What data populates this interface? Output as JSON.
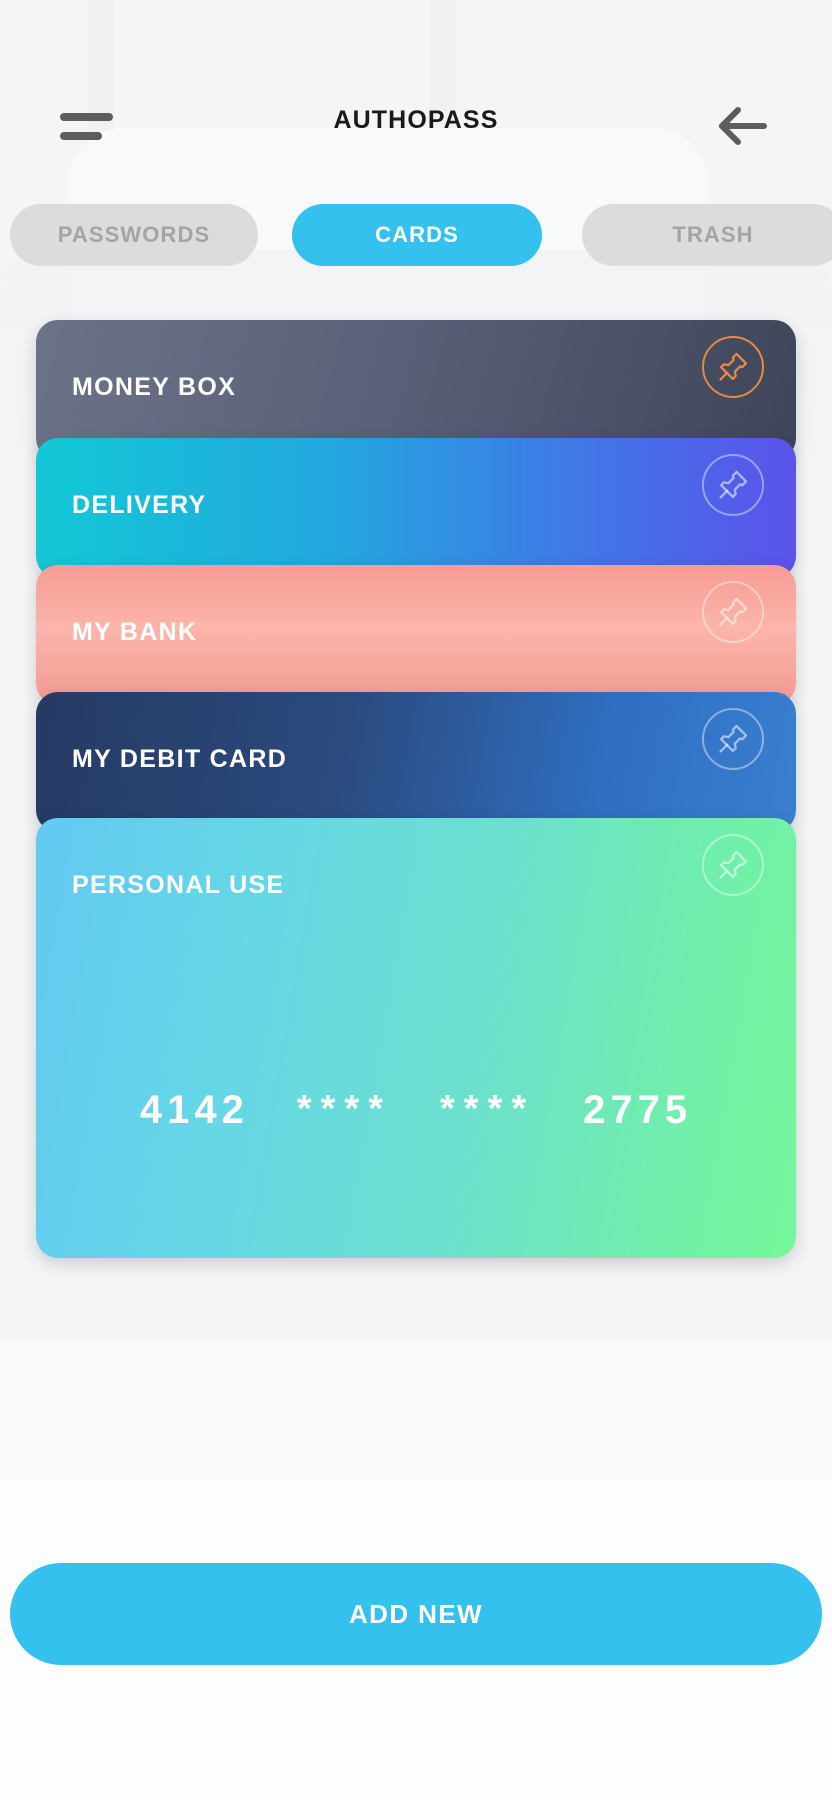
{
  "header": {
    "title": "AUTHOPASS",
    "menu_icon": "hamburger-menu-icon",
    "back_icon": "arrow-left-icon"
  },
  "tabs": [
    {
      "label": "PASSWORDS",
      "active": false
    },
    {
      "label": "CARDS",
      "active": true
    },
    {
      "label": "TRASH",
      "active": false
    }
  ],
  "cards": [
    {
      "title": "MONEY BOX",
      "pin_icon": "pushpin-icon",
      "pinned": true,
      "accent": "#e78a41"
    },
    {
      "title": "DELIVERY",
      "pin_icon": "pushpin-icon",
      "pinned": false,
      "accent": "#12c8d6"
    },
    {
      "title": "MY BANK",
      "pin_icon": "pushpin-icon",
      "pinned": false,
      "accent": "#f79b94"
    },
    {
      "title": "MY DEBIT CARD",
      "pin_icon": "pushpin-icon",
      "pinned": false,
      "accent": "#2f6fc2"
    },
    {
      "title": "PERSONAL USE",
      "pin_icon": "pushpin-icon",
      "pinned": false,
      "accent": "#6ce0cd",
      "number_groups": [
        "4142",
        "****",
        "****",
        "2775"
      ]
    }
  ],
  "footer": {
    "add_new_label": "ADD NEW"
  },
  "colors": {
    "accent_blue": "#35c1ee",
    "tab_inactive_bg": "#dcdcdc",
    "tab_inactive_text": "#a4a4a4",
    "page_bg": "#f4f5f6",
    "pin_active": "#e78a41"
  }
}
